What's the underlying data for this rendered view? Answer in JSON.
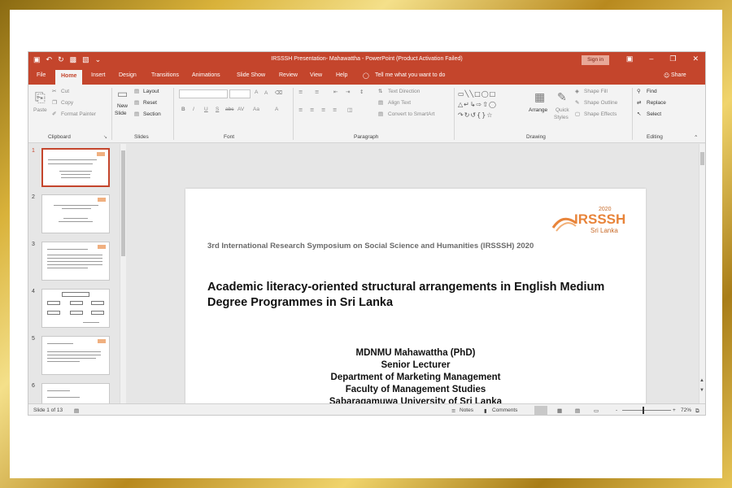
{
  "window": {
    "title": "IRSSSH Presentation- Mahawattha  -  PowerPoint (Product Activation Failed)",
    "sign_in": "Sign in"
  },
  "tabs": [
    "File",
    "Home",
    "Insert",
    "Design",
    "Transitions",
    "Animations",
    "Slide Show",
    "Review",
    "View",
    "Help"
  ],
  "tell_me": "Tell me what you want to do",
  "share": "Share",
  "ribbon": {
    "clipboard": {
      "paste": "Paste",
      "cut": "Cut",
      "copy": "Copy",
      "format_painter": "Format Painter",
      "label": "Clipboard"
    },
    "slides": {
      "new_slide_1": "New",
      "new_slide_2": "Slide",
      "layout": "Layout",
      "reset": "Reset",
      "section": "Section",
      "label": "Slides"
    },
    "font": {
      "label": "Font",
      "bold": "B",
      "italic": "I",
      "underline": "U",
      "strike": "S",
      "abc": "abc",
      "av": "AV",
      "aa": "Aa",
      "a": "A"
    },
    "paragraph": {
      "label": "Paragraph",
      "text_direction": "Text Direction",
      "align_text": "Align Text",
      "smartart": "Convert to SmartArt"
    },
    "drawing": {
      "label": "Drawing",
      "arrange": "Arrange",
      "quick_styles_1": "Quick",
      "quick_styles_2": "Styles",
      "shape_fill": "Shape Fill",
      "shape_outline": "Shape Outline",
      "shape_effects": "Shape Effects"
    },
    "editing": {
      "label": "Editing",
      "find": "Find",
      "replace": "Replace",
      "select": "Select"
    }
  },
  "thumbnails": [
    "1",
    "2",
    "3",
    "4",
    "5",
    "6"
  ],
  "slide": {
    "logo_year": "2020",
    "logo_name": "IRSSSH",
    "logo_sub": "Sri Lanka",
    "symposium": "3rd International Research Symposium on Social Science and Humanities (IRSSSH) 2020",
    "title": "Academic literacy-oriented structural arrangements in English Medium Degree Programmes in Sri Lanka",
    "author_lines": [
      "MDNMU Mahawattha (PhD)",
      "Senior Lecturer",
      "Department of Marketing Management",
      "Faculty of Management Studies",
      "Sabaragamuwa University of Sri Lanka"
    ]
  },
  "status": {
    "slide_count": "Slide 1 of 13",
    "notes": "Notes",
    "comments": "Comments",
    "zoom": "72%"
  },
  "colors": {
    "accent": "#c4452c",
    "logo_orange": "#e8843a"
  }
}
